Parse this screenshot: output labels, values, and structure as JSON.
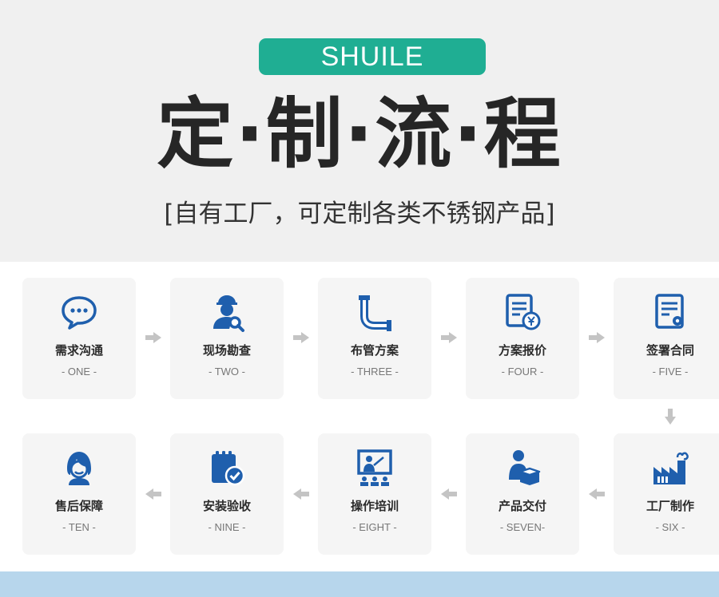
{
  "header": {
    "brand": "SHUILE",
    "title": "定·制·流·程",
    "subtitle": "[自有工厂，可定制各类不锈钢产品]",
    "accent_color": "#1fae93"
  },
  "icon_color": "#1f5fad",
  "steps": [
    {
      "title": "需求沟通",
      "num": "- ONE -",
      "icon": "chat-bubble-icon"
    },
    {
      "title": "现场勘查",
      "num": "- TWO -",
      "icon": "inspector-search-icon"
    },
    {
      "title": "布管方案",
      "num": "- THREE -",
      "icon": "pipe-icon"
    },
    {
      "title": "方案报价",
      "num": "- FOUR -",
      "icon": "quote-document-icon"
    },
    {
      "title": "签署合同",
      "num": "- FIVE -",
      "icon": "contract-icon"
    },
    {
      "title": "工厂制作",
      "num": "- SIX -",
      "icon": "factory-icon"
    },
    {
      "title": "产品交付",
      "num": "- SEVEN-",
      "icon": "delivery-person-icon"
    },
    {
      "title": "操作培训",
      "num": "- EIGHT -",
      "icon": "training-board-icon"
    },
    {
      "title": "安装验收",
      "num": "- NINE -",
      "icon": "checklist-icon"
    },
    {
      "title": "售后保障",
      "num": "- TEN -",
      "icon": "customer-service-icon"
    }
  ]
}
